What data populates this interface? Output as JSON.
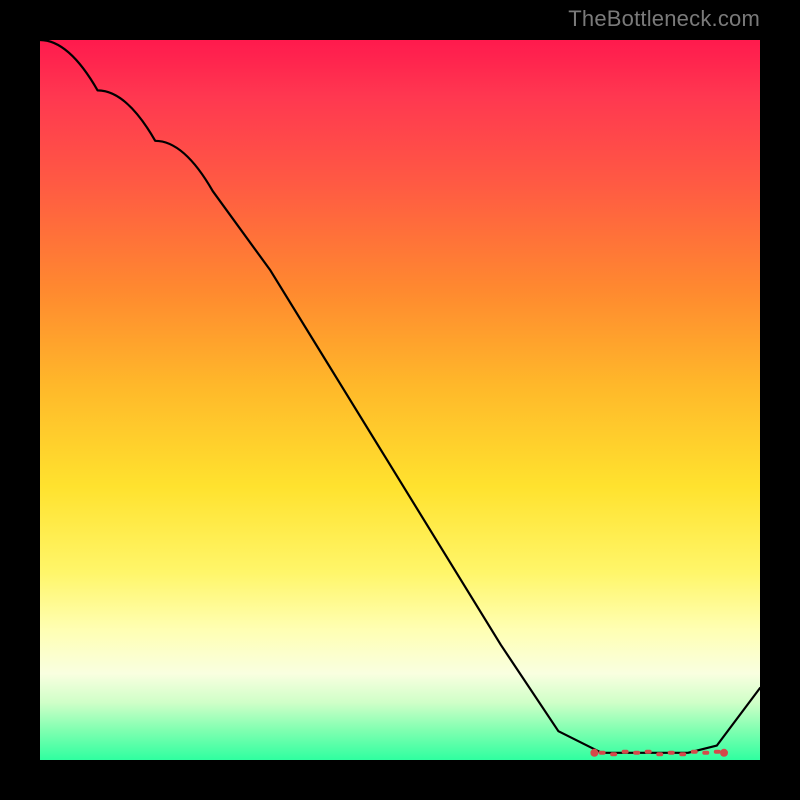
{
  "watermark": "TheBottleneck.com",
  "chart_data": {
    "type": "line",
    "title": "",
    "xlabel": "",
    "ylabel": "",
    "xlim": [
      0,
      100
    ],
    "ylim": [
      0,
      100
    ],
    "grid": false,
    "legend": false,
    "series": [
      {
        "name": "curve",
        "x": [
          0,
          8,
          16,
          24,
          32,
          40,
          48,
          56,
          64,
          72,
          78,
          82,
          86,
          90,
          94,
          100
        ],
        "y": [
          100,
          93,
          86,
          79,
          68,
          55,
          42,
          29,
          16,
          4,
          1,
          1,
          1,
          1,
          2,
          10
        ]
      }
    ],
    "annotations": {
      "dotted_valley_x_range": [
        78,
        94
      ],
      "dotted_valley_y": 1
    },
    "colors": {
      "gradient_top": "#ff1a4d",
      "gradient_mid": "#ffe22e",
      "gradient_bottom": "#2fffa0",
      "line": "#000000",
      "dots": "#d44a4a",
      "background": "#000000"
    }
  }
}
